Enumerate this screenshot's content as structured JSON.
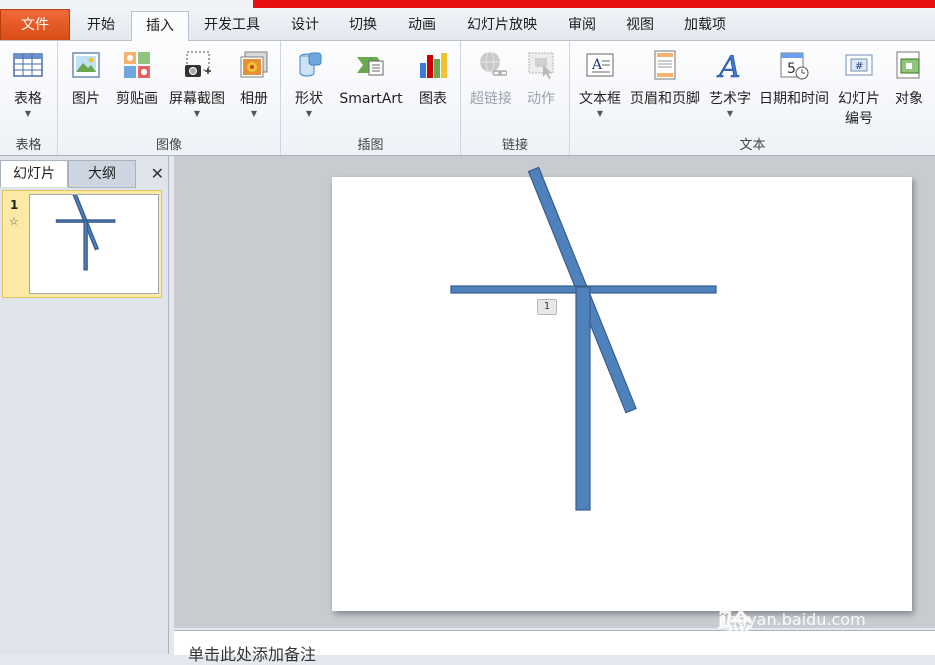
{
  "colors": {
    "file_tab": "#e05a22",
    "shape_fill": "#4f81bd",
    "shape_stroke": "#385d8a",
    "selection": "#fde9a6"
  },
  "tabs": [
    "文件",
    "开始",
    "插入",
    "开发工具",
    "设计",
    "切换",
    "动画",
    "幻灯片放映",
    "审阅",
    "视图",
    "加载项"
  ],
  "ribbon": {
    "groups": [
      {
        "label": "表格",
        "buttons": [
          {
            "label": "表格",
            "icon": "table-icon"
          }
        ]
      },
      {
        "label": "图像",
        "buttons": [
          {
            "label": "图片",
            "icon": "picture-icon"
          },
          {
            "label": "剪贴画",
            "icon": "clipart-icon"
          },
          {
            "label": "屏幕截图",
            "icon": "screenshot-icon"
          },
          {
            "label": "相册",
            "icon": "album-icon"
          }
        ]
      },
      {
        "label": "插图",
        "buttons": [
          {
            "label": "形状",
            "icon": "shapes-icon"
          },
          {
            "label": "SmartArt",
            "icon": "smartart-icon"
          },
          {
            "label": "图表",
            "icon": "chart-icon"
          }
        ]
      },
      {
        "label": "链接",
        "buttons": [
          {
            "label": "超链接",
            "icon": "hyperlink-icon"
          },
          {
            "label": "动作",
            "icon": "action-icon"
          }
        ]
      },
      {
        "label": "文本",
        "buttons": [
          {
            "label": "文本框",
            "icon": "textbox-icon"
          },
          {
            "label": "页眉和页脚",
            "icon": "header-footer-icon"
          },
          {
            "label": "艺术字",
            "icon": "wordart-icon"
          },
          {
            "label": "日期和时间",
            "icon": "datetime-icon"
          },
          {
            "label": "幻灯片编号",
            "icon": "slide-number-icon"
          },
          {
            "label": "对象",
            "icon": "object-icon"
          }
        ]
      }
    ]
  },
  "pane": {
    "tab_slides": "幻灯片",
    "tab_outline": "大纲",
    "close": "✕",
    "slide_number": "1",
    "star": "☆"
  },
  "slide": {
    "number_badge": "1"
  },
  "notes": {
    "placeholder": "单击此处添加备注"
  },
  "watermark": {
    "logo": "Bai du 经验",
    "url": "jingyan.baidu.com"
  }
}
